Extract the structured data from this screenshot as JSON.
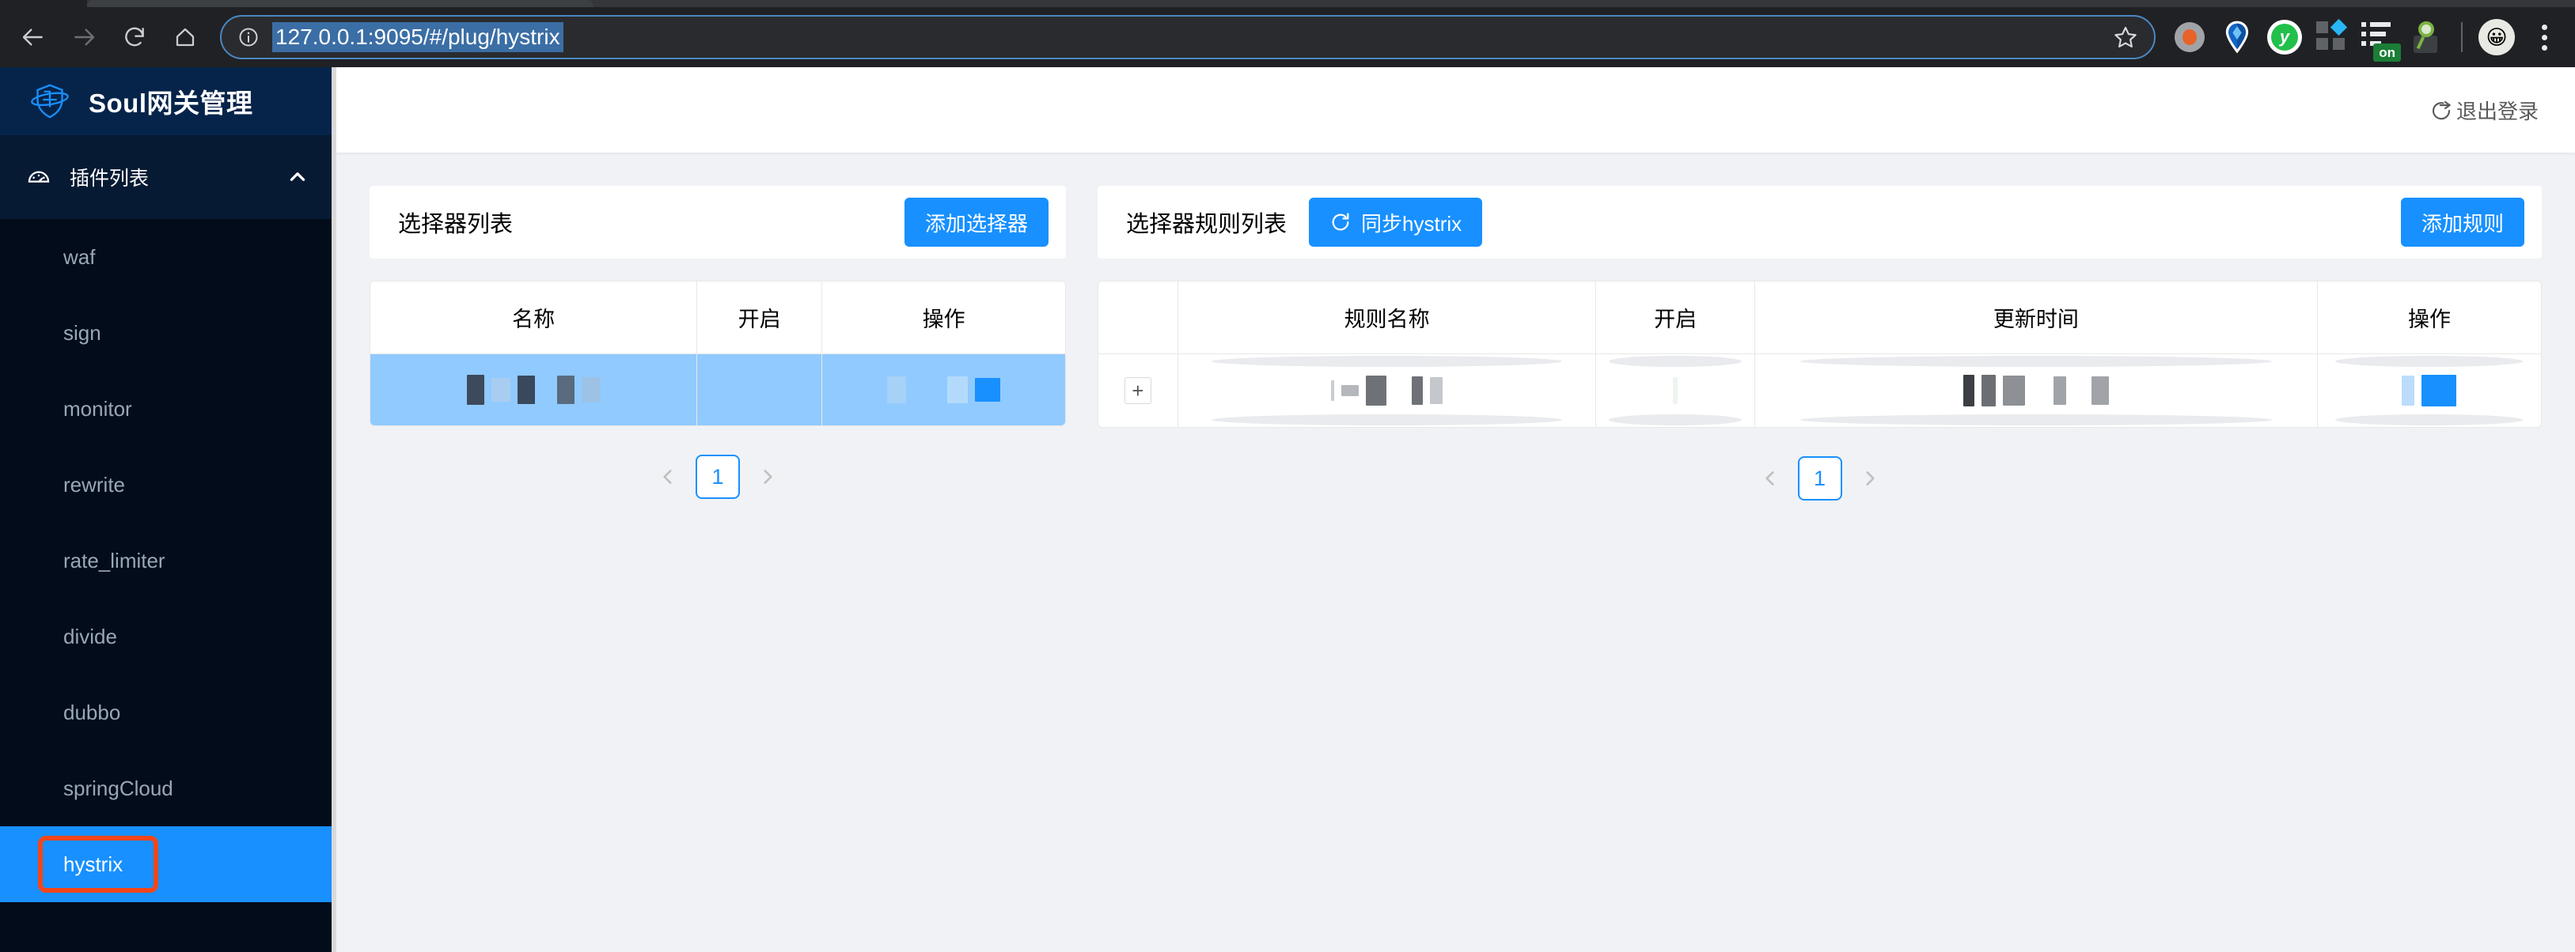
{
  "browser": {
    "nav": {
      "back_icon": "arrow-left-icon",
      "forward_icon": "arrow-right-icon",
      "reload_icon": "reload-icon",
      "home_icon": "home-icon"
    },
    "omnibox": {
      "info_icon": "site-info-icon",
      "url": "127.0.0.1:9095/#/plug/hystrix",
      "bookmark_icon": "star-icon"
    },
    "extensions": [
      {
        "name": "orange-dot-extension-icon"
      },
      {
        "name": "blue-pin-extension-icon"
      },
      {
        "name": "yandex-extension-icon",
        "glyph": "y"
      },
      {
        "name": "four-squares-extension-icon"
      },
      {
        "name": "list-extension-icon",
        "badge": "on"
      },
      {
        "name": "magnifier-extension-icon"
      }
    ],
    "profile_icon": "profile-avatar-icon",
    "menu_icon": "kebab-menu-icon"
  },
  "sidebar": {
    "brand": {
      "logo_icon": "shield-plus-logo-icon",
      "title": "Soul网关管理"
    },
    "group": {
      "icon": "dashboard-icon",
      "label": "插件列表",
      "chevron": "chevron-up-icon",
      "expanded": true
    },
    "items": [
      {
        "label": "waf",
        "active": false
      },
      {
        "label": "sign",
        "active": false
      },
      {
        "label": "monitor",
        "active": false
      },
      {
        "label": "rewrite",
        "active": false
      },
      {
        "label": "rate_limiter",
        "active": false
      },
      {
        "label": "divide",
        "active": false
      },
      {
        "label": "dubbo",
        "active": false
      },
      {
        "label": "springCloud",
        "active": false
      },
      {
        "label": "hystrix",
        "active": true
      }
    ]
  },
  "topbar": {
    "logout_icon": "logout-icon",
    "logout_label": "退出登录"
  },
  "selector_panel": {
    "title": "选择器列表",
    "add_button": "添加选择器",
    "columns": [
      "名称",
      "开启",
      "操作"
    ],
    "rows": [
      {
        "selected": true,
        "name": "",
        "enabled": "",
        "action": ""
      }
    ],
    "pagination": {
      "prev_icon": "chevron-left-icon",
      "current": "1",
      "next_icon": "chevron-right-icon"
    }
  },
  "rule_panel": {
    "title": "选择器规则列表",
    "sync_button": {
      "icon": "refresh-icon",
      "label": "同步hystrix"
    },
    "add_button": "添加规则",
    "columns": [
      "",
      "规则名称",
      "开启",
      "更新时间",
      "操作"
    ],
    "rows": [
      {
        "expand": "+",
        "rule_name": "",
        "enabled": "",
        "update_time": "",
        "action": ""
      }
    ],
    "pagination": {
      "prev_icon": "chevron-left-icon",
      "current": "1",
      "next_icon": "chevron-right-icon"
    }
  },
  "colors": {
    "accent_blue": "#1890ff",
    "sidebar_bg": "#020c1b",
    "brand_bg": "#06244a",
    "content_bg": "#f0f2f5",
    "row_selected": "#91caff",
    "annotation_orange": "#f4461b",
    "status_green": "#16c464"
  }
}
